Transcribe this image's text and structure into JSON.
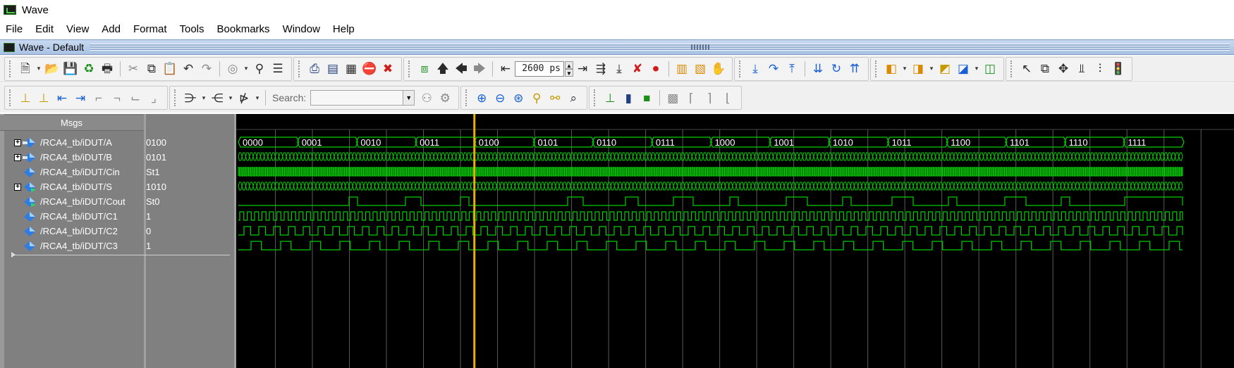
{
  "window": {
    "title": "Wave"
  },
  "menu": [
    "File",
    "Edit",
    "View",
    "Add",
    "Format",
    "Tools",
    "Bookmarks",
    "Window",
    "Help"
  ],
  "pane": {
    "title": "Wave - Default"
  },
  "toolbar": {
    "time_value": "2600 ps",
    "search_label": "Search:",
    "search_value": ""
  },
  "wave": {
    "msgs_header": "Msgs",
    "colors": {
      "signal": "#00d000",
      "cursor": "#e8b000",
      "grid": "#5a5a5a",
      "background": "#000000"
    },
    "cursor_position_fraction": 0.25,
    "signals": [
      {
        "name": "/RCA4_tb/iDUT/A",
        "value": "0100",
        "expandable": true,
        "type": "bus"
      },
      {
        "name": "/RCA4_tb/iDUT/B",
        "value": "0101",
        "expandable": true,
        "type": "bus"
      },
      {
        "name": "/RCA4_tb/iDUT/Cin",
        "value": "St1",
        "expandable": false,
        "type": "bit"
      },
      {
        "name": "/RCA4_tb/iDUT/S",
        "value": "1010",
        "expandable": true,
        "type": "bus"
      },
      {
        "name": "/RCA4_tb/iDUT/Cout",
        "value": "St0",
        "expandable": false,
        "type": "bit"
      },
      {
        "name": "/RCA4_tb/iDUT/C1",
        "value": "1",
        "expandable": false,
        "type": "bit"
      },
      {
        "name": "/RCA4_tb/iDUT/C2",
        "value": "0",
        "expandable": false,
        "type": "bit"
      },
      {
        "name": "/RCA4_tb/iDUT/C3",
        "value": "1",
        "expandable": false,
        "type": "bit"
      }
    ],
    "bus_a_labels": [
      "0000",
      "0001",
      "0010",
      "0011",
      "0100",
      "0101",
      "0110",
      "0111",
      "1000",
      "1001",
      "1010",
      "1011",
      "1100",
      "1101",
      "1110",
      "1111"
    ]
  }
}
